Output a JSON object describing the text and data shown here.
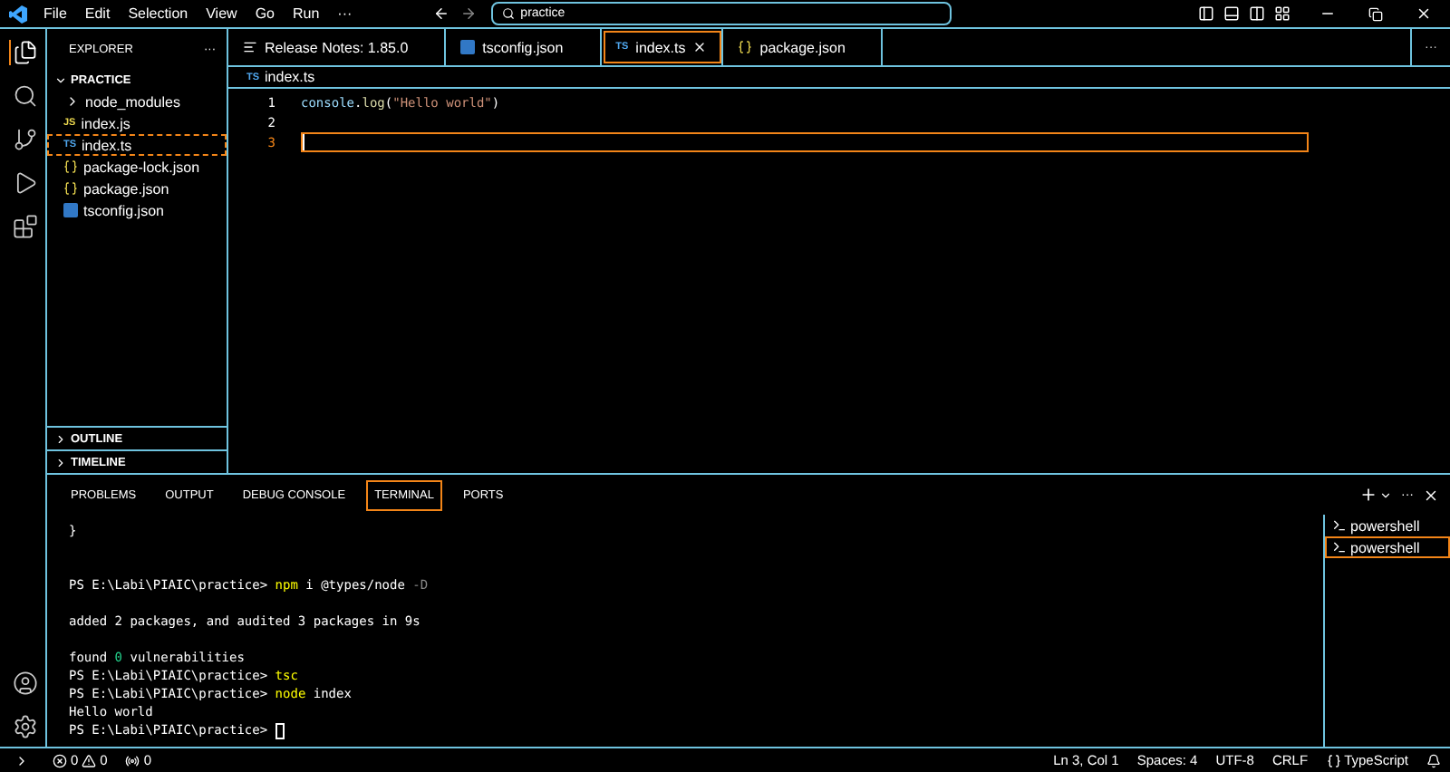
{
  "title_bar": {
    "menus": [
      "File",
      "Edit",
      "Selection",
      "View",
      "Go",
      "Run",
      "···"
    ],
    "search": {
      "value": "practice"
    }
  },
  "activity_bar": {
    "items": [
      {
        "kind": "files",
        "selected": true
      },
      {
        "kind": "search",
        "selected": false
      },
      {
        "kind": "source-control",
        "selected": false
      },
      {
        "kind": "run",
        "selected": false
      },
      {
        "kind": "extensions",
        "selected": false
      }
    ],
    "bottom": [
      {
        "kind": "account"
      },
      {
        "kind": "settings"
      }
    ]
  },
  "sidebar": {
    "title": "EXPLORER",
    "more": "···",
    "folder": {
      "label": "PRACTICE",
      "expanded": true,
      "children": [
        {
          "label": "node_modules",
          "kind": "folder",
          "selected": false
        },
        {
          "label": "index.js",
          "kind": "js",
          "badge": "JS",
          "selected": false
        },
        {
          "label": "index.ts",
          "kind": "ts",
          "badge": "TS",
          "selected": true
        },
        {
          "label": "package-lock.json",
          "kind": "json",
          "selected": false
        },
        {
          "label": "package.json",
          "kind": "json",
          "selected": false
        },
        {
          "label": "tsconfig.json",
          "kind": "tsconfig",
          "selected": false
        }
      ]
    },
    "sections": [
      {
        "label": "OUTLINE",
        "expanded": false
      },
      {
        "label": "TIMELINE",
        "expanded": false
      }
    ]
  },
  "tabs": [
    {
      "label": "Release Notes: 1.85.0",
      "kind": "notes",
      "selected": false
    },
    {
      "label": "tsconfig.json",
      "kind": "tsconfig",
      "selected": false
    },
    {
      "label": "index.ts",
      "kind": "ts",
      "badge": "TS",
      "selected": true
    },
    {
      "label": "package.json",
      "kind": "json",
      "selected": false
    }
  ],
  "tabs_more": "···",
  "breadcrumb": {
    "label": "index.ts",
    "kind": "ts",
    "badge": "TS"
  },
  "editor": {
    "lines": [
      {
        "number": "1",
        "current": false,
        "tokens": [
          {
            "text": "console",
            "kind": "variable"
          },
          {
            "text": ".",
            "kind": "plain"
          },
          {
            "text": "log",
            "kind": "function"
          },
          {
            "text": "(",
            "kind": "plain"
          },
          {
            "text": "\"Hello world\"",
            "kind": "string"
          },
          {
            "text": ")",
            "kind": "plain"
          }
        ]
      },
      {
        "number": "2",
        "current": false
      },
      {
        "number": "3",
        "current": true
      }
    ]
  },
  "panel": {
    "tabs": [
      {
        "label": "PROBLEMS",
        "selected": false
      },
      {
        "label": "OUTPUT",
        "selected": false
      },
      {
        "label": "DEBUG CONSOLE",
        "selected": false
      },
      {
        "label": "TERMINAL",
        "selected": true
      },
      {
        "label": "PORTS",
        "selected": false
      }
    ],
    "terminal_lines": [
      {
        "kind": "text",
        "segments": [
          {
            "text": "}",
            "kind": "output"
          }
        ]
      },
      {
        "kind": "blank"
      },
      {
        "kind": "blank"
      },
      {
        "kind": "text",
        "segments": [
          {
            "text": "PS E:\\Labi\\PIAIC\\practice> ",
            "kind": "output"
          },
          {
            "text": "npm",
            "kind": "command"
          },
          {
            "text": " i @types/node ",
            "kind": "output"
          },
          {
            "text": "-D",
            "kind": "flag"
          }
        ]
      },
      {
        "kind": "blank"
      },
      {
        "kind": "text",
        "segments": [
          {
            "text": "added 2 packages, and audited 3 packages in 9s",
            "kind": "output"
          }
        ]
      },
      {
        "kind": "blank"
      },
      {
        "kind": "text",
        "segments": [
          {
            "text": "found ",
            "kind": "output"
          },
          {
            "text": "0",
            "kind": "success"
          },
          {
            "text": " vulnerabilities",
            "kind": "output"
          }
        ]
      },
      {
        "kind": "text",
        "segments": [
          {
            "text": "PS E:\\Labi\\PIAIC\\practice> ",
            "kind": "output"
          },
          {
            "text": "tsc",
            "kind": "command"
          }
        ]
      },
      {
        "kind": "text",
        "segments": [
          {
            "text": "PS E:\\Labi\\PIAIC\\practice> ",
            "kind": "output"
          },
          {
            "text": "node",
            "kind": "command"
          },
          {
            "text": " index",
            "kind": "output"
          }
        ]
      },
      {
        "kind": "text",
        "segments": [
          {
            "text": "Hello world",
            "kind": "output"
          }
        ]
      },
      {
        "kind": "text",
        "cursor": true,
        "segments": [
          {
            "text": "PS E:\\Labi\\PIAIC\\practice> ",
            "kind": "output"
          }
        ]
      }
    ],
    "terminals": [
      {
        "label": "powershell",
        "selected": false
      },
      {
        "label": "powershell",
        "selected": true
      }
    ]
  },
  "status_bar": {
    "errors": "0",
    "warnings": "0",
    "ports": "0",
    "right": [
      "Ln 3, Col 1",
      "Spaces: 4",
      "UTF-8",
      "CRLF"
    ],
    "language": "TypeScript"
  }
}
